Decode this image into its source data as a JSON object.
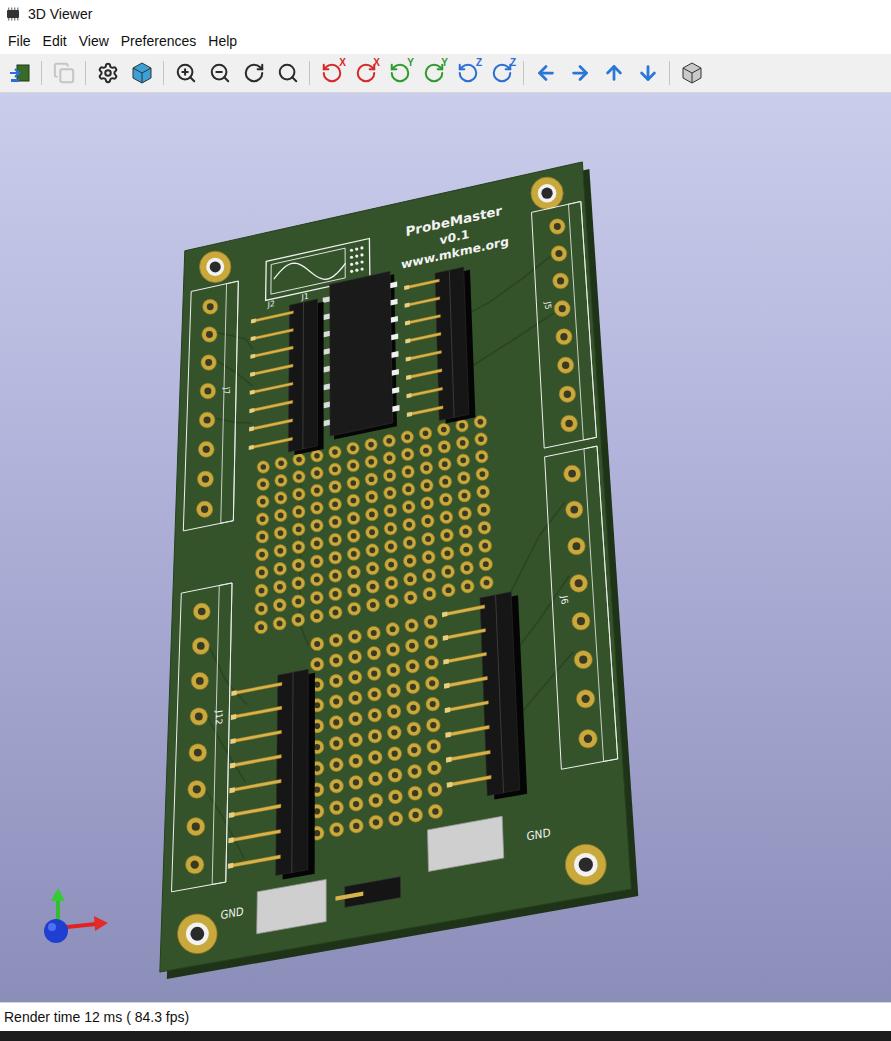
{
  "window": {
    "title": "3D Viewer"
  },
  "menu": [
    {
      "label": "File"
    },
    {
      "label": "Edit"
    },
    {
      "label": "View"
    },
    {
      "label": "Preferences"
    },
    {
      "label": "Help"
    }
  ],
  "toolbar": [
    [
      {
        "disabled": false
      }
    ],
    [
      {
        "disabled": true
      }
    ],
    [
      {
        "disabled": false
      },
      {
        "disabled": false
      }
    ],
    [
      {
        "disabled": false
      },
      {
        "disabled": false
      },
      {
        "disabled": false
      },
      {
        "disabled": false
      }
    ],
    [
      {
        "disabled": false,
        "glyph": "X",
        "color": "#d42a2a"
      },
      {
        "disabled": false,
        "glyph": "X",
        "color": "#d42a2a"
      },
      {
        "disabled": false,
        "glyph": "Y",
        "color": "#2f9a2f"
      },
      {
        "disabled": false,
        "glyph": "Y",
        "color": "#2f9a2f"
      },
      {
        "disabled": false,
        "glyph": "Z",
        "color": "#2a6fd4"
      },
      {
        "disabled": false,
        "glyph": "Z",
        "color": "#2a6fd4"
      }
    ],
    [
      {
        "disabled": false
      },
      {
        "disabled": false
      },
      {
        "disabled": false
      },
      {
        "disabled": false
      }
    ],
    [
      {
        "disabled": false
      }
    ]
  ],
  "board": {
    "title": "ProbeMaster",
    "version": "v0.1",
    "url": "www.mkme.org",
    "gnd_labels": [
      "GND",
      "GND"
    ],
    "references": [
      "J1",
      "J2",
      "J7",
      "J12",
      "J5",
      "J6"
    ]
  },
  "status_bar": {
    "text": "Render time 12 ms ( 84.3 fps)"
  }
}
